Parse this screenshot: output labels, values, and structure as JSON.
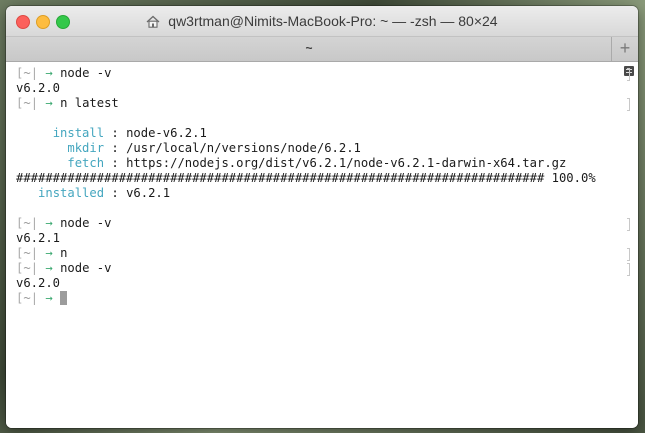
{
  "window": {
    "title": "qw3rtman@Nimits-MacBook-Pro: ~ — -zsh — 80×24",
    "tab_label": "~",
    "new_tab_label": "+"
  },
  "prompt": {
    "open_bracket": "[",
    "tilde": "~",
    "bar": "|",
    "arrow": "→"
  },
  "terminal": {
    "lines": [
      {
        "type": "prompt",
        "command": "node -v"
      },
      {
        "type": "output",
        "text": "v6.2.0"
      },
      {
        "type": "prompt",
        "command": "n latest"
      },
      {
        "type": "blank"
      },
      {
        "type": "kv",
        "key": "install",
        "value": "node-v6.2.1"
      },
      {
        "type": "kv",
        "key": "mkdir",
        "value": "/usr/local/n/versions/node/6.2.1"
      },
      {
        "type": "kv",
        "key": "fetch",
        "value": "https://nodejs.org/dist/v6.2.1/node-v6.2.1-darwin-x64.tar.gz"
      },
      {
        "type": "output",
        "text": "######################################################################## 100.0%"
      },
      {
        "type": "kv",
        "key": "installed",
        "value": "v6.2.1"
      },
      {
        "type": "blank"
      },
      {
        "type": "prompt",
        "command": "node -v"
      },
      {
        "type": "output",
        "text": "v6.2.1"
      },
      {
        "type": "prompt",
        "command": "n"
      },
      {
        "type": "prompt",
        "command": "node -v"
      },
      {
        "type": "output",
        "text": "v6.2.0"
      },
      {
        "type": "prompt",
        "command": "",
        "cursor": true
      }
    ]
  },
  "colors": {
    "prompt_arrow": "#3aa86f",
    "key_text": "#44a6bf",
    "close": "#fc605c",
    "minimize": "#fdbc40",
    "maximize": "#34c84a"
  }
}
